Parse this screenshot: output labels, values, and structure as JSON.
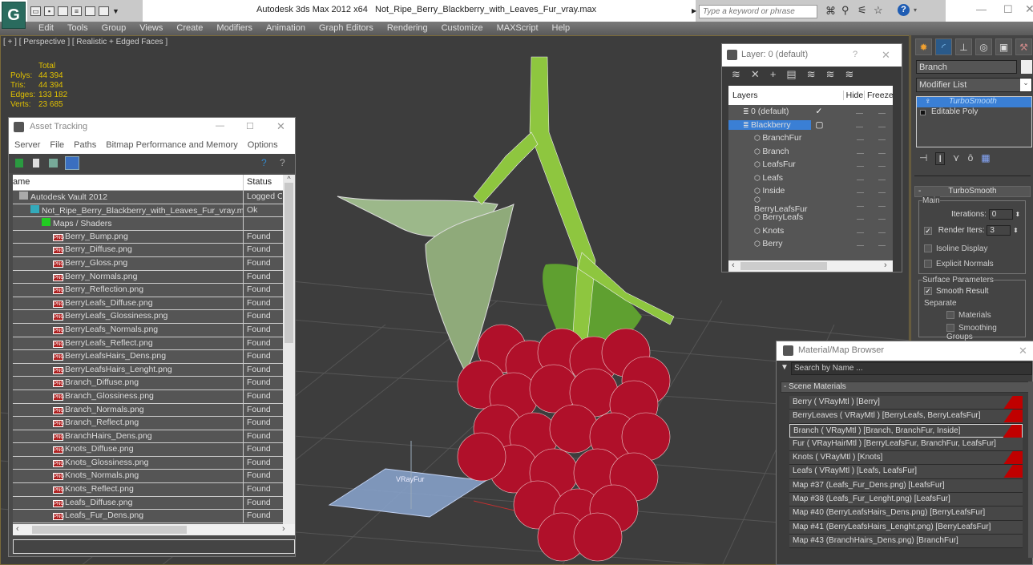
{
  "titlebar": {
    "app_title": "Autodesk 3ds Max  2012 x64",
    "file_title": "Not_Ripe_Berry_Blackberry_with_Leaves_Fur_vray.max",
    "search_placeholder": "Type a keyword or phrase",
    "icons": [
      "binoculars-icon",
      "key-icon",
      "satellite-icon",
      "star-icon",
      "help-icon"
    ],
    "help_label": "?"
  },
  "menu": [
    "Edit",
    "Tools",
    "Group",
    "Views",
    "Create",
    "Modifiers",
    "Animation",
    "Graph Editors",
    "Rendering",
    "Customize",
    "MAXScript",
    "Help"
  ],
  "viewport": {
    "label": "[ + ] [ Perspective ] [ Realistic + Edged Faces ]",
    "stats_header": "Total",
    "stats": [
      {
        "label": "Polys:",
        "value": "44 394"
      },
      {
        "label": "Tris:",
        "value": "44 394"
      },
      {
        "label": "Edges:",
        "value": "133 182"
      },
      {
        "label": "Verts:",
        "value": "23 685"
      }
    ],
    "gizmo_label": "VRayFur"
  },
  "asset_tracking": {
    "title": "Asset Tracking",
    "menu": [
      "Server",
      "File",
      "Paths",
      "Bitmap Performance and Memory",
      "Options"
    ],
    "columns": [
      "ame",
      "Status"
    ],
    "rows": [
      {
        "name": "Autodesk Vault 2012",
        "status": "Logged O",
        "level": 0,
        "icon": "vault-icon"
      },
      {
        "name": "Not_Ripe_Berry_Blackberry_with_Leaves_Fur_vray.max",
        "status": "Ok",
        "level": 1,
        "icon": "max-file-icon"
      },
      {
        "name": "Maps / Shaders",
        "status": "",
        "level": 2,
        "icon": "maps-icon"
      },
      {
        "name": "Berry_Bump.png",
        "status": "Found",
        "level": 3,
        "icon": "png-icon"
      },
      {
        "name": "Berry_Diffuse.png",
        "status": "Found",
        "level": 3,
        "icon": "png-icon"
      },
      {
        "name": "Berry_Gloss.png",
        "status": "Found",
        "level": 3,
        "icon": "png-icon"
      },
      {
        "name": "Berry_Normals.png",
        "status": "Found",
        "level": 3,
        "icon": "png-icon"
      },
      {
        "name": "Berry_Reflection.png",
        "status": "Found",
        "level": 3,
        "icon": "png-icon"
      },
      {
        "name": "BerryLeafs_Diffuse.png",
        "status": "Found",
        "level": 3,
        "icon": "png-icon"
      },
      {
        "name": "BerryLeafs_Glossiness.png",
        "status": "Found",
        "level": 3,
        "icon": "png-icon"
      },
      {
        "name": "BerryLeafs_Normals.png",
        "status": "Found",
        "level": 3,
        "icon": "png-icon"
      },
      {
        "name": "BerryLeafs_Reflect.png",
        "status": "Found",
        "level": 3,
        "icon": "png-icon"
      },
      {
        "name": "BerryLeafsHairs_Dens.png",
        "status": "Found",
        "level": 3,
        "icon": "png-icon"
      },
      {
        "name": "BerryLeafsHairs_Lenght.png",
        "status": "Found",
        "level": 3,
        "icon": "png-icon"
      },
      {
        "name": "Branch_Diffuse.png",
        "status": "Found",
        "level": 3,
        "icon": "png-icon"
      },
      {
        "name": "Branch_Glossiness.png",
        "status": "Found",
        "level": 3,
        "icon": "png-icon"
      },
      {
        "name": "Branch_Normals.png",
        "status": "Found",
        "level": 3,
        "icon": "png-icon"
      },
      {
        "name": "Branch_Reflect.png",
        "status": "Found",
        "level": 3,
        "icon": "png-icon"
      },
      {
        "name": "BranchHairs_Dens.png",
        "status": "Found",
        "level": 3,
        "icon": "png-icon"
      },
      {
        "name": "Knots_Diffuse.png",
        "status": "Found",
        "level": 3,
        "icon": "png-icon"
      },
      {
        "name": "Knots_Glossiness.png",
        "status": "Found",
        "level": 3,
        "icon": "png-icon"
      },
      {
        "name": "Knots_Normals.png",
        "status": "Found",
        "level": 3,
        "icon": "png-icon"
      },
      {
        "name": "Knots_Reflect.png",
        "status": "Found",
        "level": 3,
        "icon": "png-icon"
      },
      {
        "name": "Leafs_Diffuse.png",
        "status": "Found",
        "level": 3,
        "icon": "png-icon"
      },
      {
        "name": "Leafs_Fur_Dens.png",
        "status": "Found",
        "level": 3,
        "icon": "png-icon"
      }
    ],
    "png_badge": "PNG",
    "path_value": ""
  },
  "layers": {
    "title": "Layer: 0 (default)",
    "help": "?",
    "columns": [
      "Layers",
      "Hide",
      "Freeze"
    ],
    "rows": [
      {
        "name": "0 (default)",
        "level": 0,
        "active": true,
        "selected": false
      },
      {
        "name": "Blackberry",
        "level": 0,
        "active": false,
        "selected": true
      },
      {
        "name": "BranchFur",
        "level": 1
      },
      {
        "name": "Branch",
        "level": 1
      },
      {
        "name": "LeafsFur",
        "level": 1
      },
      {
        "name": "Leafs",
        "level": 1
      },
      {
        "name": "Inside",
        "level": 1
      },
      {
        "name": "BerryLeafsFur",
        "level": 1
      },
      {
        "name": "BerryLeafs",
        "level": 1
      },
      {
        "name": "Knots",
        "level": 1
      },
      {
        "name": "Berry",
        "level": 1
      }
    ]
  },
  "command_panel": {
    "object_name": "Branch",
    "modifier_list": "Modifier List",
    "stack": [
      {
        "name": "TurboSmooth",
        "selected": true
      },
      {
        "name": "Editable Poly",
        "selected": false
      }
    ],
    "rollout_title": "TurboSmooth",
    "collapse": "-",
    "main_group": "Main",
    "iterations_label": "Iterations:",
    "iterations_value": "0",
    "render_iters_label": "Render Iters:",
    "render_iters_value": "3",
    "render_iters_checked": true,
    "isoline_label": "Isoline Display",
    "explicit_label": "Explicit Normals",
    "surface_group": "Surface Parameters",
    "smooth_result_label": "Smooth Result",
    "separate_label": "Separate",
    "materials_label": "Materials",
    "smoothing_groups_label": "Smoothing Groups"
  },
  "material_browser": {
    "title": "Material/Map Browser",
    "search_placeholder": "Search by Name ...",
    "group": "- Scene Materials",
    "items": [
      {
        "label": "Berry  ( VRayMtl ) [Berry]",
        "flag": true,
        "selected": false
      },
      {
        "label": "BerryLeaves  ( VRayMtl ) [BerryLeafs, BerryLeafsFur]",
        "flag": true,
        "selected": false
      },
      {
        "label": "Branch  ( VRayMtl ) [Branch, BranchFur, Inside]",
        "flag": true,
        "selected": true
      },
      {
        "label": "Fur  ( VRayHairMtl ) [BerryLeafsFur, BranchFur, LeafsFur]",
        "flag": false,
        "selected": false
      },
      {
        "label": "Knots  ( VRayMtl ) [Knots]",
        "flag": true,
        "selected": false
      },
      {
        "label": "Leafs  ( VRayMtl ) [Leafs, LeafsFur]",
        "flag": true,
        "selected": false
      },
      {
        "label": "Map #37 (Leafs_Fur_Dens.png) [LeafsFur]",
        "flag": false,
        "selected": false
      },
      {
        "label": "Map #38 (Leafs_Fur_Lenght.png) [LeafsFur]",
        "flag": false,
        "selected": false
      },
      {
        "label": "Map #40 (BerryLeafsHairs_Dens.png) [BerryLeafsFur]",
        "flag": false,
        "selected": false
      },
      {
        "label": "Map #41 (BerryLeafsHairs_Lenght.png) [BerryLeafsFur]",
        "flag": false,
        "selected": false
      },
      {
        "label": "Map #43 (BranchHairs_Dens.png) [BranchFur]",
        "flag": false,
        "selected": false
      }
    ]
  },
  "colors": {
    "accent": "#3a7fd5",
    "viewport_bg": "#3d3d3d",
    "stats": "#e0c000",
    "berry": "#b0102a",
    "stem": "#8ec63f"
  }
}
